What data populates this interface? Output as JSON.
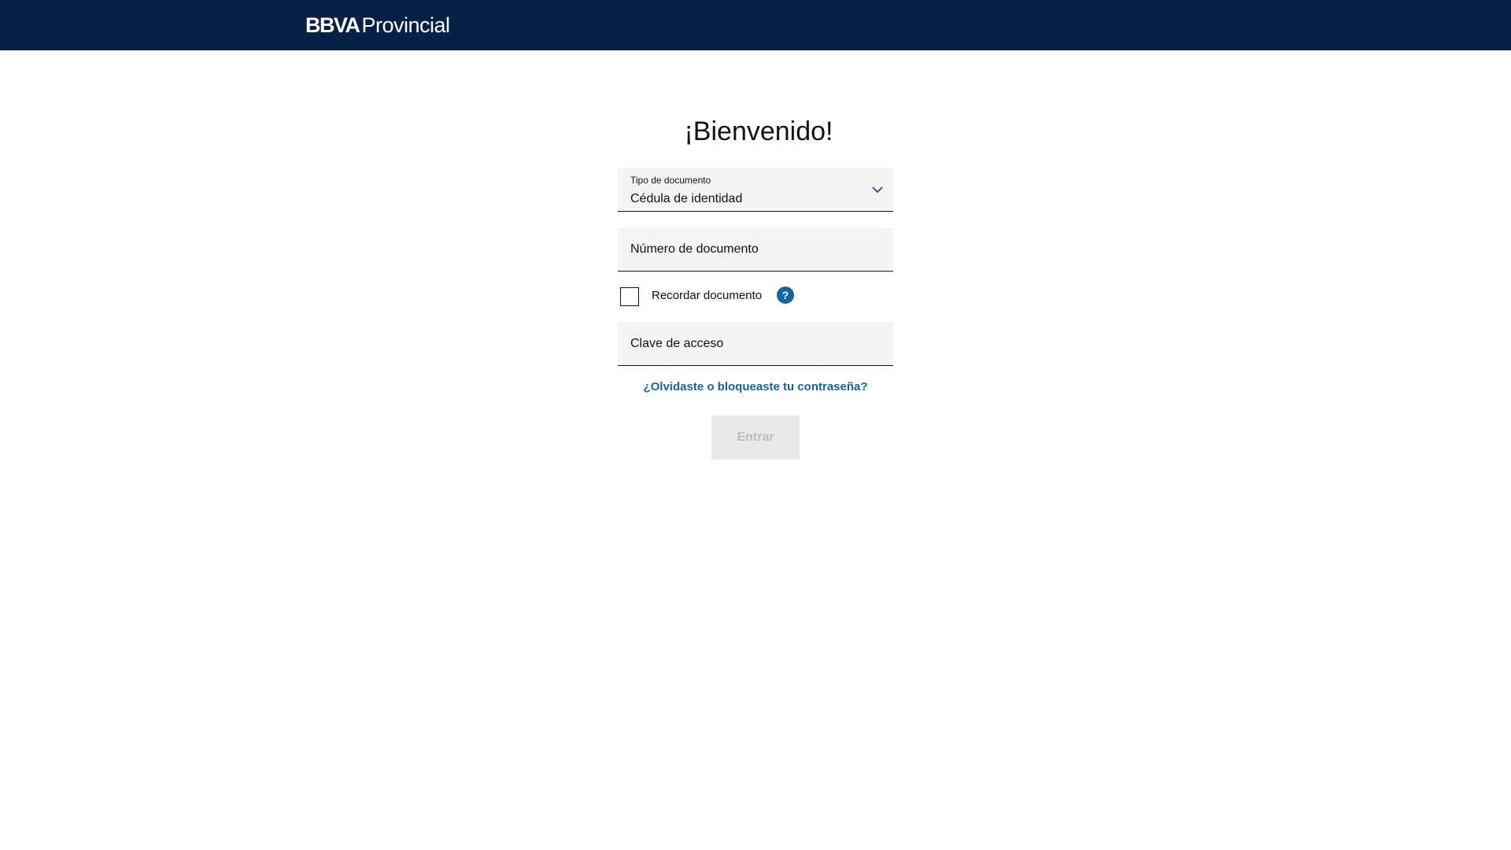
{
  "header": {
    "logo_brand": "BBVA",
    "logo_name": "Provincial",
    "background_color": "#072146"
  },
  "main": {
    "title": "¡Bienvenido!",
    "document_type": {
      "label": "Tipo de documento",
      "selected_value": "Cédula de identidad",
      "icon": "chevron-down-icon"
    },
    "document_number": {
      "placeholder": "Número de documento",
      "value": ""
    },
    "remember_document": {
      "label": "Recordar documento",
      "checked": false,
      "help_icon": "question-icon",
      "help_glyph": "?"
    },
    "password": {
      "placeholder": "Clave de acceso",
      "value": ""
    },
    "forgot_link": "¿Olvidaste o bloqueaste tu contraseña?",
    "submit_label": "Entrar"
  },
  "colors": {
    "accent": "#1464a5",
    "field_background": "#f4f4f4",
    "button_disabled_bg": "#e9e9e9",
    "button_disabled_text": "#bdbdbd"
  }
}
